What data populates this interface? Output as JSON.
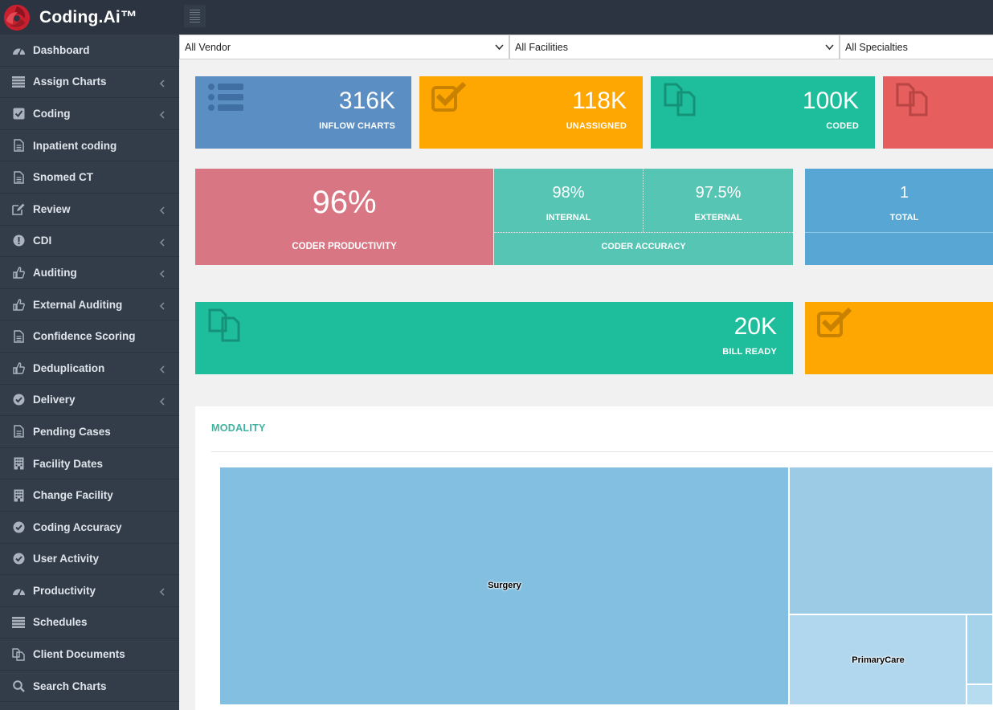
{
  "app": {
    "brand": "Coding.Ai™",
    "accent_red": "#c8202e"
  },
  "sidebar": {
    "items": [
      {
        "label": "Dashboard",
        "icon": "dashboard-icon",
        "has_submenu": false
      },
      {
        "label": "Assign Charts",
        "icon": "list-icon",
        "has_submenu": true
      },
      {
        "label": "Coding",
        "icon": "checkbox-icon",
        "has_submenu": true
      },
      {
        "label": "Inpatient coding",
        "icon": "document-icon",
        "has_submenu": false
      },
      {
        "label": "Snomed CT",
        "icon": "document-icon",
        "has_submenu": false
      },
      {
        "label": "Review",
        "icon": "edit-icon",
        "has_submenu": true
      },
      {
        "label": "CDI",
        "icon": "exclamation-icon",
        "has_submenu": true
      },
      {
        "label": "Auditing",
        "icon": "thumbs-up-icon",
        "has_submenu": true
      },
      {
        "label": "External Auditing",
        "icon": "thumbs-up-icon",
        "has_submenu": true
      },
      {
        "label": "Confidence Scoring",
        "icon": "document-icon",
        "has_submenu": false
      },
      {
        "label": "Deduplication",
        "icon": "thumbs-up-icon",
        "has_submenu": true
      },
      {
        "label": "Delivery",
        "icon": "check-circle-icon",
        "has_submenu": true
      },
      {
        "label": "Pending Cases",
        "icon": "document-icon",
        "has_submenu": false
      },
      {
        "label": "Facility Dates",
        "icon": "building-icon",
        "has_submenu": false
      },
      {
        "label": "Change Facility",
        "icon": "building-icon",
        "has_submenu": false
      },
      {
        "label": "Coding Accuracy",
        "icon": "check-circle-icon",
        "has_submenu": false
      },
      {
        "label": "User Activity",
        "icon": "check-circle-icon",
        "has_submenu": false
      },
      {
        "label": "Productivity",
        "icon": "dashboard-icon",
        "has_submenu": true
      },
      {
        "label": "Schedules",
        "icon": "list-icon",
        "has_submenu": false
      },
      {
        "label": "Client Documents",
        "icon": "copy-icon",
        "has_submenu": false
      },
      {
        "label": "Search Charts",
        "icon": "search-icon",
        "has_submenu": false
      }
    ]
  },
  "filters": {
    "vendor": "All Vendor",
    "facilities": "All Facilities",
    "specialties": "All Specialties"
  },
  "tiles": {
    "inflow": {
      "value": "316K",
      "label": "INFLOW CHARTS",
      "color": "#5b8ec2"
    },
    "unassigned": {
      "value": "118K",
      "label": "UNASSIGNED",
      "color": "#fea601"
    },
    "coded": {
      "value": "100K",
      "label": "CODED",
      "color": "#1ebe9c"
    },
    "fourth": {
      "color": "#e65f5e"
    },
    "bill_ready": {
      "value": "20K",
      "label": "BILL READY",
      "color": "#1ebe9c"
    },
    "orange2": {
      "color": "#fea601"
    }
  },
  "productivity": {
    "value": "96%",
    "label": "CODER PRODUCTIVITY",
    "color": "#d87684"
  },
  "accuracy": {
    "internal_value": "98%",
    "internal_label": "INTERNAL",
    "external_value": "97.5%",
    "external_label": "EXTERNAL",
    "label": "CODER ACCURACY",
    "color": "#57c5b4"
  },
  "total": {
    "value": "1",
    "label": "TOTAL",
    "color": "#58a6d4"
  },
  "modality": {
    "title": "MODALITY",
    "cells": [
      {
        "label": "Surgery",
        "color": "#82bfe0"
      },
      {
        "label": "",
        "color": "#9ccbe6"
      },
      {
        "label": "PrimaryCare",
        "color": "#b0d7ed"
      },
      {
        "label": "",
        "color": "#a6d2ea"
      },
      {
        "label": "",
        "color": "#b8dcef"
      }
    ]
  }
}
